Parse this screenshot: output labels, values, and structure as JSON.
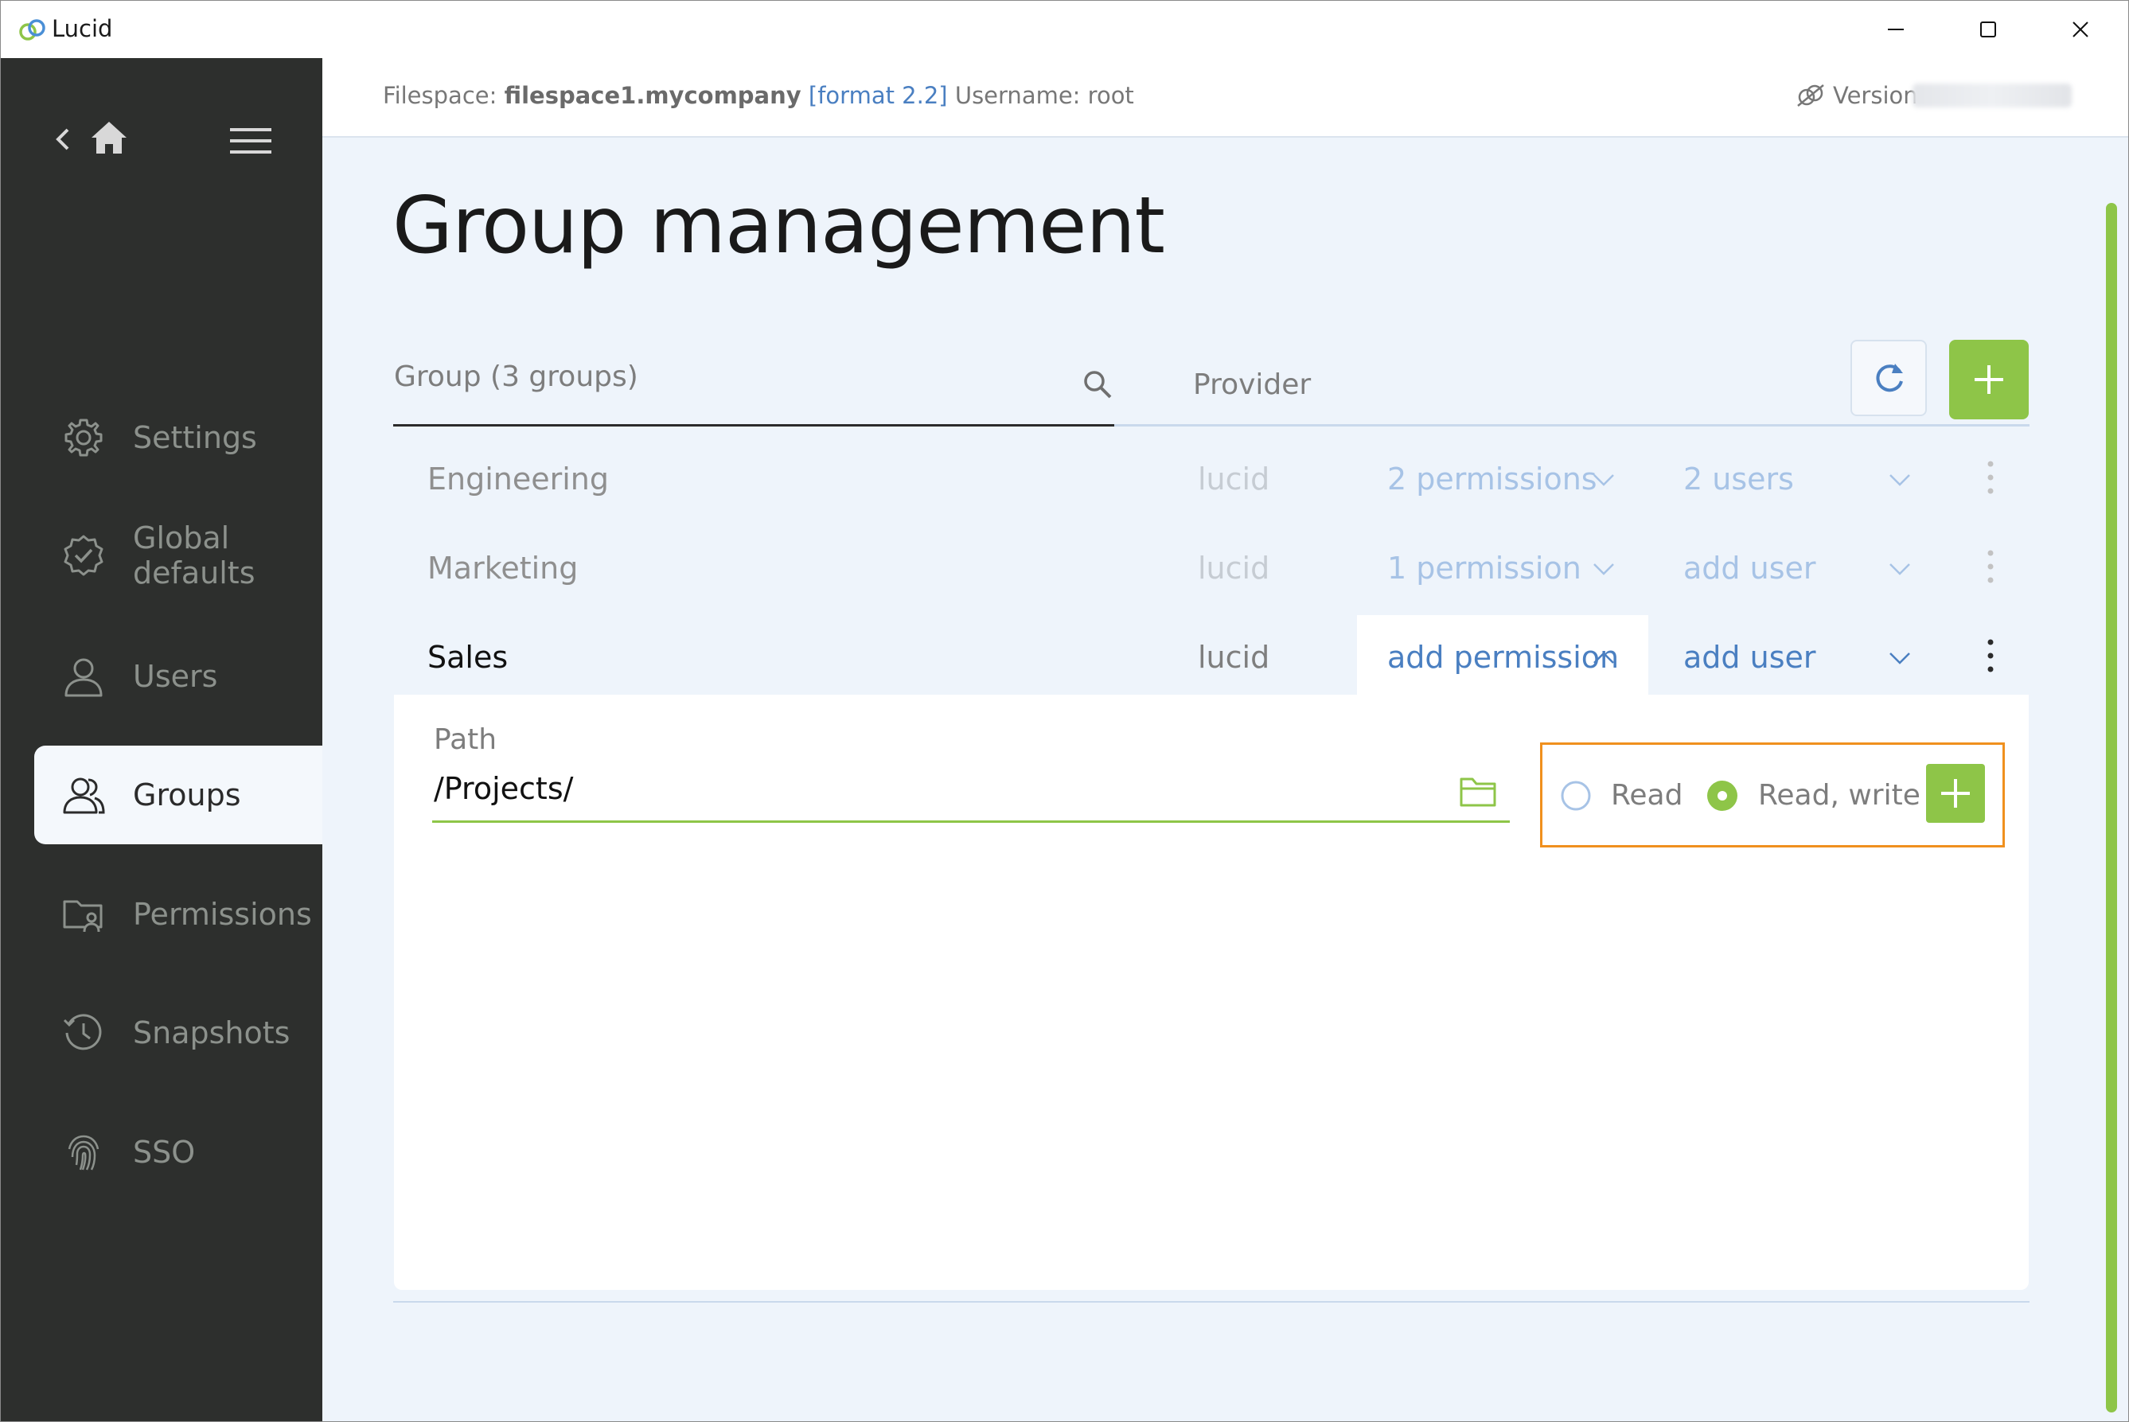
{
  "app": {
    "title": "Lucid"
  },
  "window_controls": {
    "minimize": "minimize-icon",
    "maximize": "maximize-icon",
    "close": "close-icon"
  },
  "sidebar": {
    "items": [
      {
        "label": "Settings",
        "icon": "gear-icon"
      },
      {
        "label": "Global defaults",
        "icon": "badge-check-icon"
      },
      {
        "label": "Users",
        "icon": "user-icon"
      },
      {
        "label": "Groups",
        "icon": "users-icon",
        "active": true
      },
      {
        "label": "Permissions",
        "icon": "folder-user-icon"
      },
      {
        "label": "Snapshots",
        "icon": "history-icon"
      },
      {
        "label": "SSO",
        "icon": "fingerprint-icon"
      }
    ]
  },
  "header": {
    "filespace_label": "Filespace:",
    "filespace_name": "filespace1.mycompany",
    "format": "[format 2.2]",
    "username": "Username: root",
    "version_label": "Version"
  },
  "page": {
    "title": "Group management"
  },
  "filters": {
    "group_label": "Group (3 groups)",
    "provider_label": "Provider"
  },
  "groups": [
    {
      "name": "Engineering",
      "provider": "lucid",
      "permissions": "2 permissions",
      "users": "2 users"
    },
    {
      "name": "Marketing",
      "provider": "lucid",
      "permissions": "1 permission",
      "users": "add user"
    },
    {
      "name": "Sales",
      "provider": "lucid",
      "permissions": "add permission",
      "users": "add user",
      "expanded": true
    }
  ],
  "permission_panel": {
    "path_label": "Path",
    "path_value": "/Projects/",
    "options": [
      {
        "label": "Read",
        "selected": false
      },
      {
        "label": "Read, write",
        "selected": true
      }
    ]
  },
  "colors": {
    "accent_green": "#8ec548",
    "link_blue": "#4a7fc1",
    "highlight_orange": "#f0901e",
    "sidebar_bg": "#2d2f2d"
  }
}
